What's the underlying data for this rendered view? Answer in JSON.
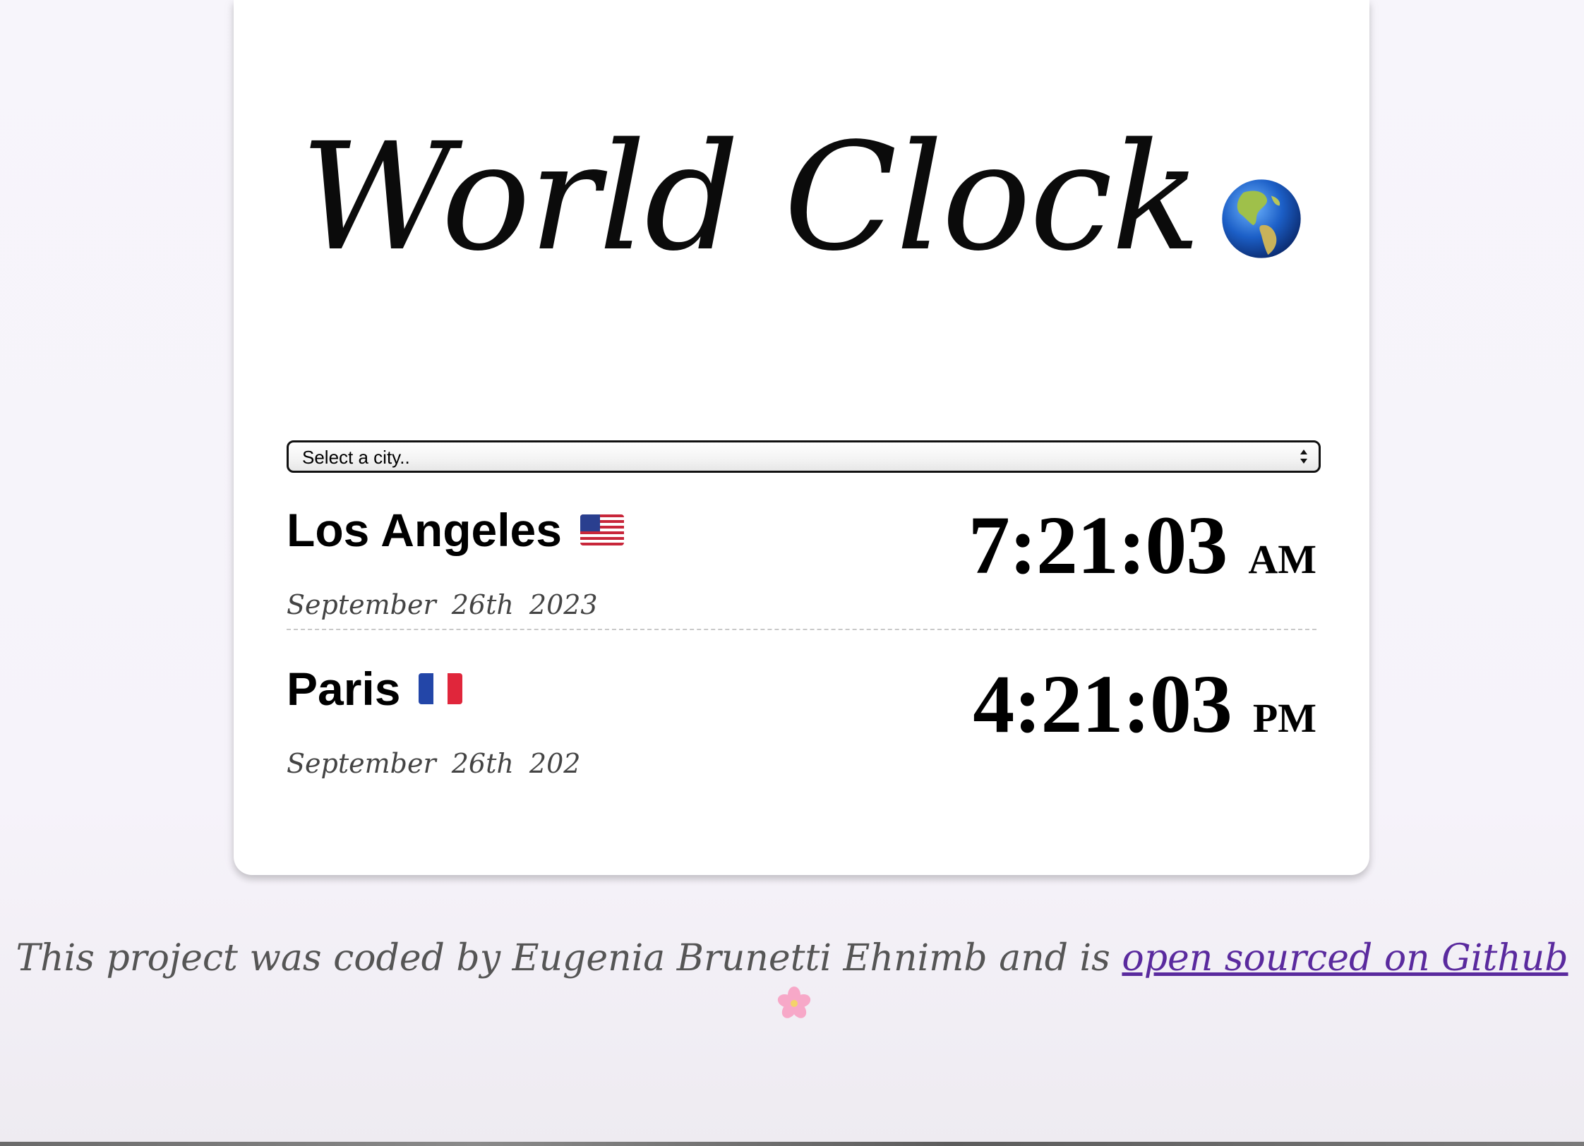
{
  "header": {
    "title": "World Clock",
    "title_icon": "globe-americas-icon"
  },
  "selector": {
    "selected_value": "Select a city..",
    "arrow_icon": "up-down-chevron-icon"
  },
  "cities": [
    {
      "name": "Los Angeles",
      "flag_icon": "us-flag-icon",
      "month": "September",
      "day_year": "26th 2023",
      "time": "7:21:03",
      "ampm": "AM"
    },
    {
      "name": "Paris",
      "flag_icon": "france-flag-icon",
      "month": "September",
      "day_year": "26th 202",
      "time": "4:21:03",
      "ampm": "PM"
    }
  ],
  "footer": {
    "text": "This project was coded by Eugenia Brunetti Ehnimb and is ",
    "link_text": "open sourced on Github",
    "icon": "cherry-blossom-icon",
    "link_color": "#5a2a9e"
  }
}
